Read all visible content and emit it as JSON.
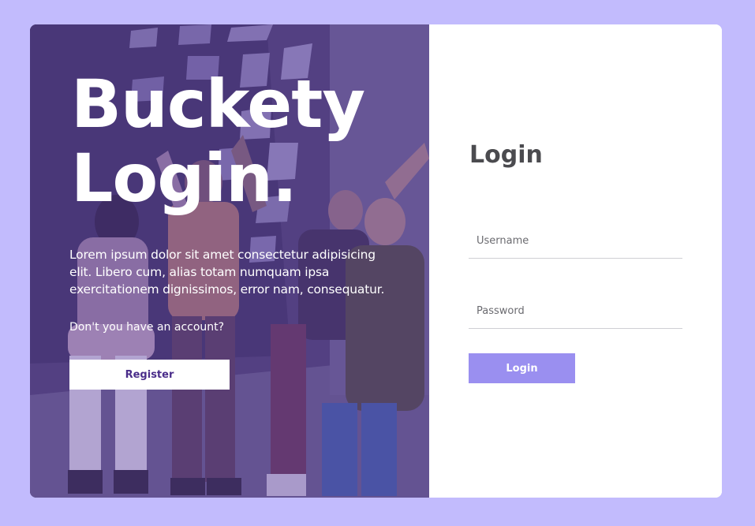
{
  "hero": {
    "title_line1": "Buckety",
    "title_line2": "Login.",
    "description": "Lorem ipsum dolor sit amet consectetur adipisicing elit. Libero cum, alias totam numquam ipsa exercitationem dignissimos, error nam, consequatur.",
    "question": "Don't you have an account?",
    "register_label": "Register",
    "image": "group-of-friends-celebrating-photo"
  },
  "form": {
    "title": "Login",
    "username_placeholder": "Username",
    "password_placeholder": "Password",
    "login_label": "Login"
  },
  "colors": {
    "page_background": "#c2bbfd",
    "hero_overlay": "#5c40a0",
    "login_button": "#9a8ff0",
    "register_text": "#4a2d8a",
    "title_text": "#4b4b4f"
  }
}
